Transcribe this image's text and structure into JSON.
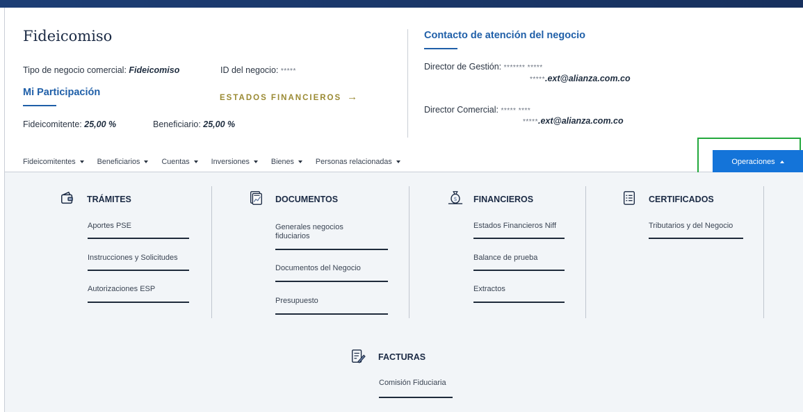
{
  "header": {
    "title": "Fideicomiso",
    "business_type_label": "Tipo de negocio comercial:",
    "business_type_value": "Fideicomiso",
    "business_id_label": "ID del negocio:",
    "business_id_value": "*****",
    "participation_heading": "Mi Participación",
    "financial_statements_link": "ESTADOS FINANCIEROS",
    "fideicomitente_label": "Fideicomitente:",
    "fideicomitente_value": "25,00 %",
    "beneficiario_label": "Beneficiario:",
    "beneficiario_value": "25,00 %"
  },
  "contact": {
    "heading": "Contacto de atención del negocio",
    "director_gestion_label": "Director de Gestión:",
    "director_gestion_name": "******* *****",
    "director_gestion_email_mask": "*****",
    "director_gestion_email": ".ext@alianza.com.co",
    "director_comercial_label": "Director Comercial:",
    "director_comercial_name": "***** ****",
    "director_comercial_email_mask": "*****",
    "director_comercial_email": ".ext@alianza.com.co"
  },
  "nav": {
    "items": [
      {
        "label": "Fideicomitentes"
      },
      {
        "label": "Beneficiarios"
      },
      {
        "label": "Cuentas"
      },
      {
        "label": "Inversiones"
      },
      {
        "label": "Bienes"
      },
      {
        "label": "Personas relacionadas"
      }
    ],
    "operations_button": "Operaciones"
  },
  "menu": {
    "tramites": {
      "title": "TRÁMITES",
      "icon": "wallet-icon",
      "links": [
        "Aportes PSE",
        "Instrucciones y Solicitudes",
        "Autorizaciones ESP"
      ]
    },
    "documentos": {
      "title": "DOCUMENTOS",
      "icon": "documents-chart-icon",
      "links": [
        "Generales negocios fiduciarios",
        "Documentos del Negocio",
        "Presupuesto"
      ]
    },
    "financieros": {
      "title": "FINANCIEROS",
      "icon": "money-bag-icon",
      "links": [
        "Estados Financieros Niff",
        "Balance de prueba",
        "Extractos"
      ]
    },
    "certificados": {
      "title": "CERTIFICADOS",
      "icon": "certificate-list-icon",
      "links": [
        "Tributarios y del Negocio"
      ]
    },
    "facturas": {
      "title": "FACTURAS",
      "icon": "invoice-pen-icon",
      "links": [
        "Comisión Fiduciaria"
      ]
    }
  },
  "colors": {
    "brand_dark": "#1d3e75",
    "accent_blue": "#1f5fa8",
    "button_blue": "#1474d9",
    "gold_link": "#9a8a33",
    "highlight_green": "#22a83c",
    "panel_bg": "#f2f5f8"
  }
}
